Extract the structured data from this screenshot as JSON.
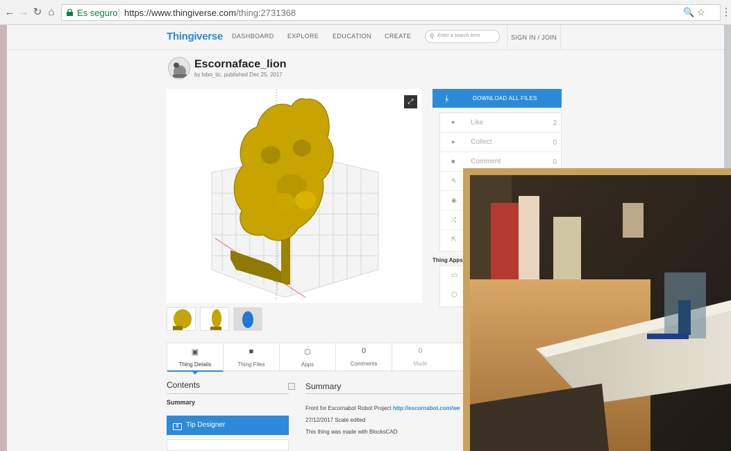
{
  "browser": {
    "secure_label": "Es seguro",
    "url_host": "https://www.thingiverse.com",
    "url_path": "/thing:2731368"
  },
  "nav": {
    "logo": "Thingiverse",
    "links": [
      "DASHBOARD",
      "EXPLORE",
      "EDUCATION",
      "CREATE"
    ],
    "search_placeholder": "Enter a search term",
    "signin": "SIGN IN / JOIN"
  },
  "thing": {
    "title": "Escornaface_lion",
    "byline": "by lobo_tic, published Dec 25, 2017"
  },
  "sidebar": {
    "download": "DOWNLOAD ALL FILES",
    "actions": [
      {
        "label": "Like",
        "count": "2"
      },
      {
        "label": "Collect",
        "count": "0"
      },
      {
        "label": "Comment",
        "count": "0"
      }
    ],
    "thing_apps": "Thing Apps"
  },
  "tabs": [
    {
      "label": "Thing Details",
      "active": true
    },
    {
      "label": "Thing Files"
    },
    {
      "label": "Apps"
    },
    {
      "label": "Comments",
      "count": "0"
    },
    {
      "label": "Made",
      "count": "0"
    }
  ],
  "contents": {
    "heading": "Contents",
    "summary": "Summary",
    "tip_designer": "Tip Designer"
  },
  "summary": {
    "heading": "Summary",
    "line1_text": "Front for Escornabot Robot Project ",
    "line1_link": "http://escornabot.com/we",
    "line2": "27/12/2017 Scale edited",
    "line3": "This thing was made with BlocksCAD"
  },
  "colors": {
    "accent": "#2d8ad9",
    "model": "#c7a400",
    "photo_frame": "#caa15a"
  }
}
